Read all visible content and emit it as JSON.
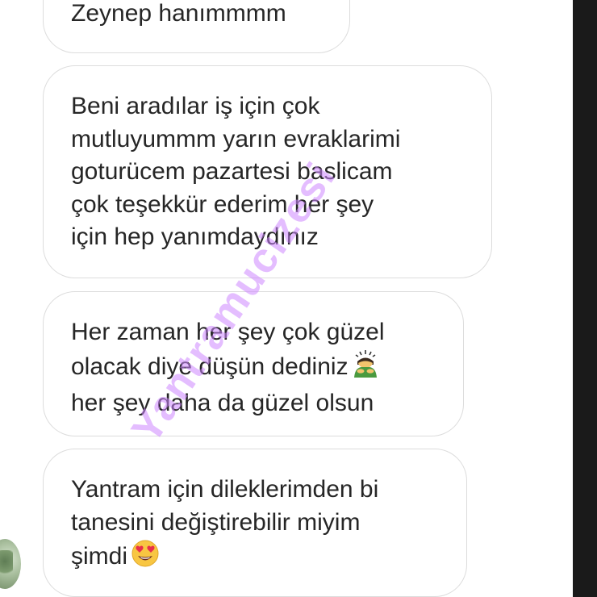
{
  "messages": [
    {
      "lines": [
        "Zeynep hanımmmm"
      ]
    },
    {
      "lines": [
        "Beni aradılar iş için çok",
        "mutluyummm yarın evraklarimi",
        "goturücem pazartesi baslicam",
        "çok teşekkür ederim her şey",
        "için hep yanımdaydınız"
      ]
    },
    {
      "lines": [
        "Her zaman her şey çok güzel",
        "olacak diye düşün dediniz",
        "her şey daha da güzel olsun"
      ]
    },
    {
      "lines": [
        "Yantram için dileklerimden bi",
        "tanesini değiştirebilir miyim",
        "şimdi"
      ]
    }
  ],
  "watermark": "Yantramucizesi",
  "icons": {
    "person_bowing": "person-bowing-icon",
    "heart_eyes": "heart-eyes-emoji-icon"
  },
  "colors": {
    "bubble_border": "#dcdcdc",
    "text": "#262626",
    "watermark": "#ce86ff",
    "right_bar": "#1a1a1a"
  }
}
